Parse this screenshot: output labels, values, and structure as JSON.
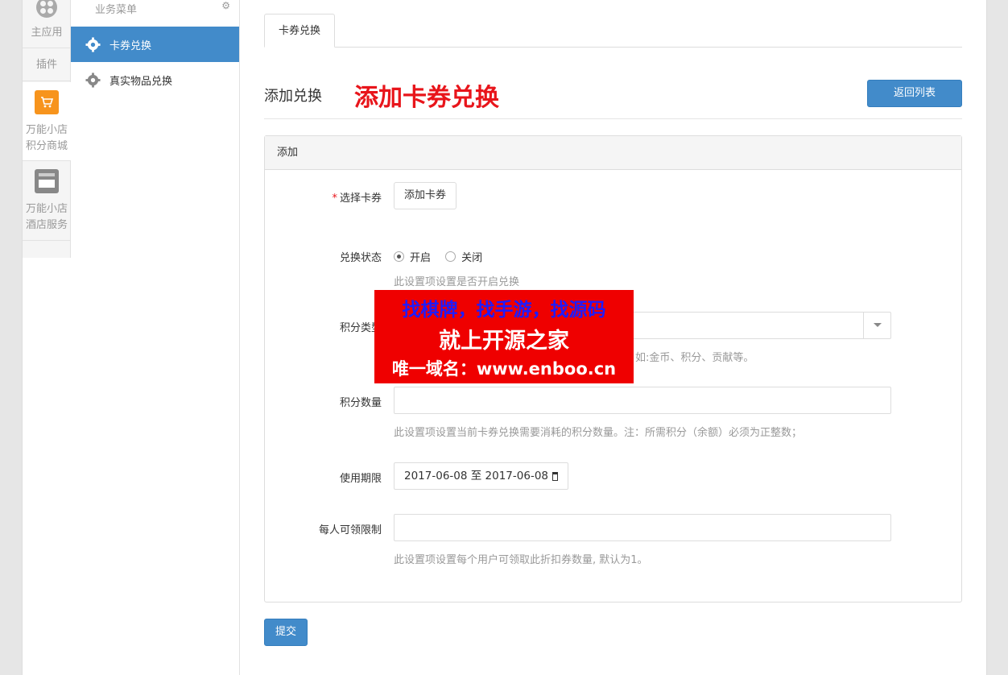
{
  "rail": {
    "main_apps": "主应用",
    "plugins": "插件",
    "mall_icon_text": "积分商城",
    "mall_line1": "万能小店",
    "mall_line2": "积分商城",
    "hotel_line1": "万能小店",
    "hotel_line2": "酒店服务"
  },
  "menu": {
    "title": "业务菜单",
    "items": [
      {
        "label": "卡券兑换",
        "icon": "gear-icon",
        "active": true
      },
      {
        "label": "真实物品兑换",
        "icon": "gear-icon",
        "active": false
      }
    ]
  },
  "tabs": [
    {
      "label": "卡券兑换"
    }
  ],
  "heading": {
    "title": "添加兑换",
    "highlight": "添加卡券兑换",
    "back_label": "返回列表"
  },
  "panel": {
    "title": "添加",
    "card": {
      "label": "选择卡券",
      "required_mark": "*",
      "button": "添加卡券"
    },
    "status": {
      "label": "兑换状态",
      "options": [
        {
          "label": "开启",
          "checked": true
        },
        {
          "label": "关闭",
          "checked": false
        }
      ],
      "help": "此设置项设置是否开启兑换"
    },
    "credit_type": {
      "label": "积分类型",
      "value": "",
      "help": "如:金币、积分、贡献等。"
    },
    "credit_amount": {
      "label": "积分数量",
      "value": "",
      "help": "此设置项设置当前卡券兑换需要消耗的积分数量。注：所需积分（余额）必须为正整数；"
    },
    "validity": {
      "label": "使用期限",
      "value": "2017-06-08 至 2017-06-08"
    },
    "per_user_limit": {
      "label": "每人可领限制",
      "value": "",
      "help": "此设置项设置每个用户可领取此折扣券数量, 默认为1。"
    }
  },
  "submit_label": "提交",
  "watermark": {
    "line1": "找棋牌，找手游，找源码",
    "line2": "就上开源之家",
    "line3": "唯一域名：www.enboo.cn"
  },
  "colors": {
    "primary": "#428bca",
    "highlight_red": "#e8151b",
    "watermark_bg": "#ef0000",
    "watermark_blue": "#1e1cff"
  }
}
